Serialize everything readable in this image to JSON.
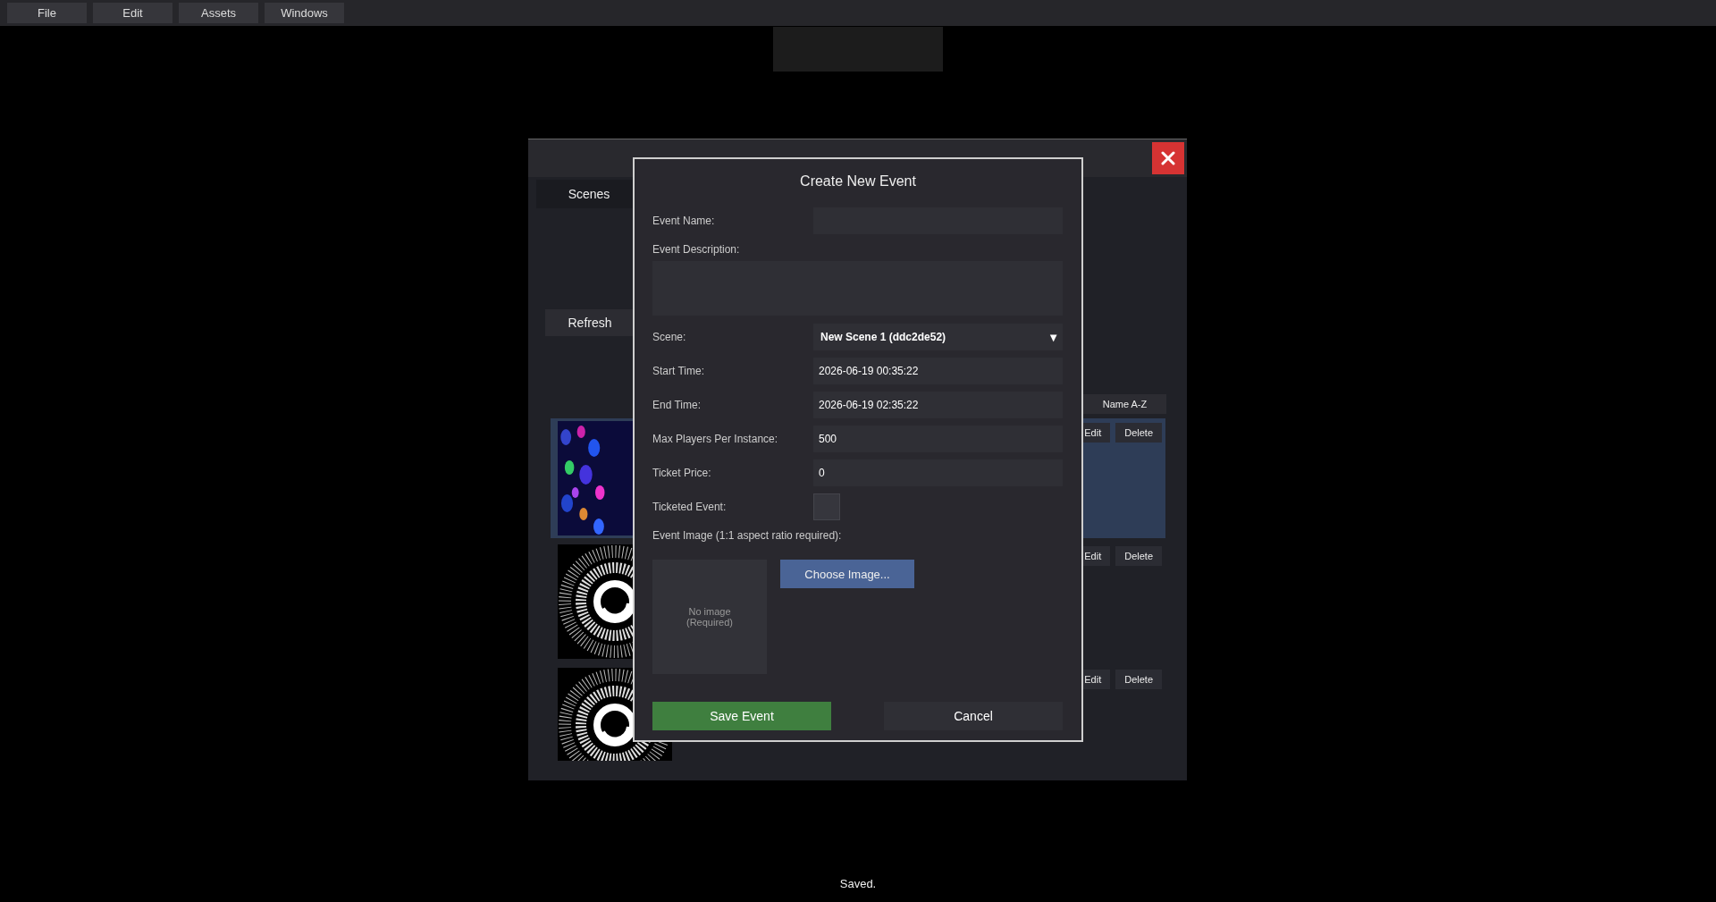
{
  "menu": [
    {
      "label": "File"
    },
    {
      "label": "Edit"
    },
    {
      "label": "Assets"
    },
    {
      "label": "Windows"
    }
  ],
  "window": {
    "tabs": [
      {
        "label": "Scenes",
        "selected": true
      }
    ],
    "refresh_button": "Refresh",
    "sort_button": "Name A-Z",
    "scenes": [
      {
        "selected": true,
        "edit_button": "Edit",
        "delete_button": "Delete"
      },
      {
        "selected": false,
        "edit_button": "Edit",
        "delete_button": "Delete"
      },
      {
        "selected": false,
        "edit_button": "Edit",
        "delete_button": "Delete"
      }
    ]
  },
  "dialog": {
    "title": "Create New Event",
    "fields": [
      {
        "kind": "text",
        "label": "Event Name:"
      },
      {
        "kind": "textarea",
        "label": "Event Description:"
      },
      {
        "kind": "select",
        "label": "Scene:",
        "value": "New Scene 1 (ddc2de52)",
        "arrow": "▼"
      },
      {
        "kind": "text",
        "label": "Start Time:",
        "value": "2026-06-19 00:35:22"
      },
      {
        "kind": "text",
        "label": "End Time:",
        "value": "2026-06-19 02:35:22"
      },
      {
        "kind": "text",
        "label": "Max Players Per Instance:",
        "value": "500"
      },
      {
        "kind": "text",
        "label": "Ticket Price:",
        "value": "0"
      },
      {
        "kind": "checkbox",
        "label": "Ticketed Event:",
        "checked": false
      }
    ],
    "image_label": "Event Image (1:1 aspect ratio required):",
    "preview_text": "No image\n(Required)",
    "choose_button": "Choose Image...",
    "save_button": "Save Event",
    "cancel_button": "Cancel"
  },
  "status": "Saved."
}
